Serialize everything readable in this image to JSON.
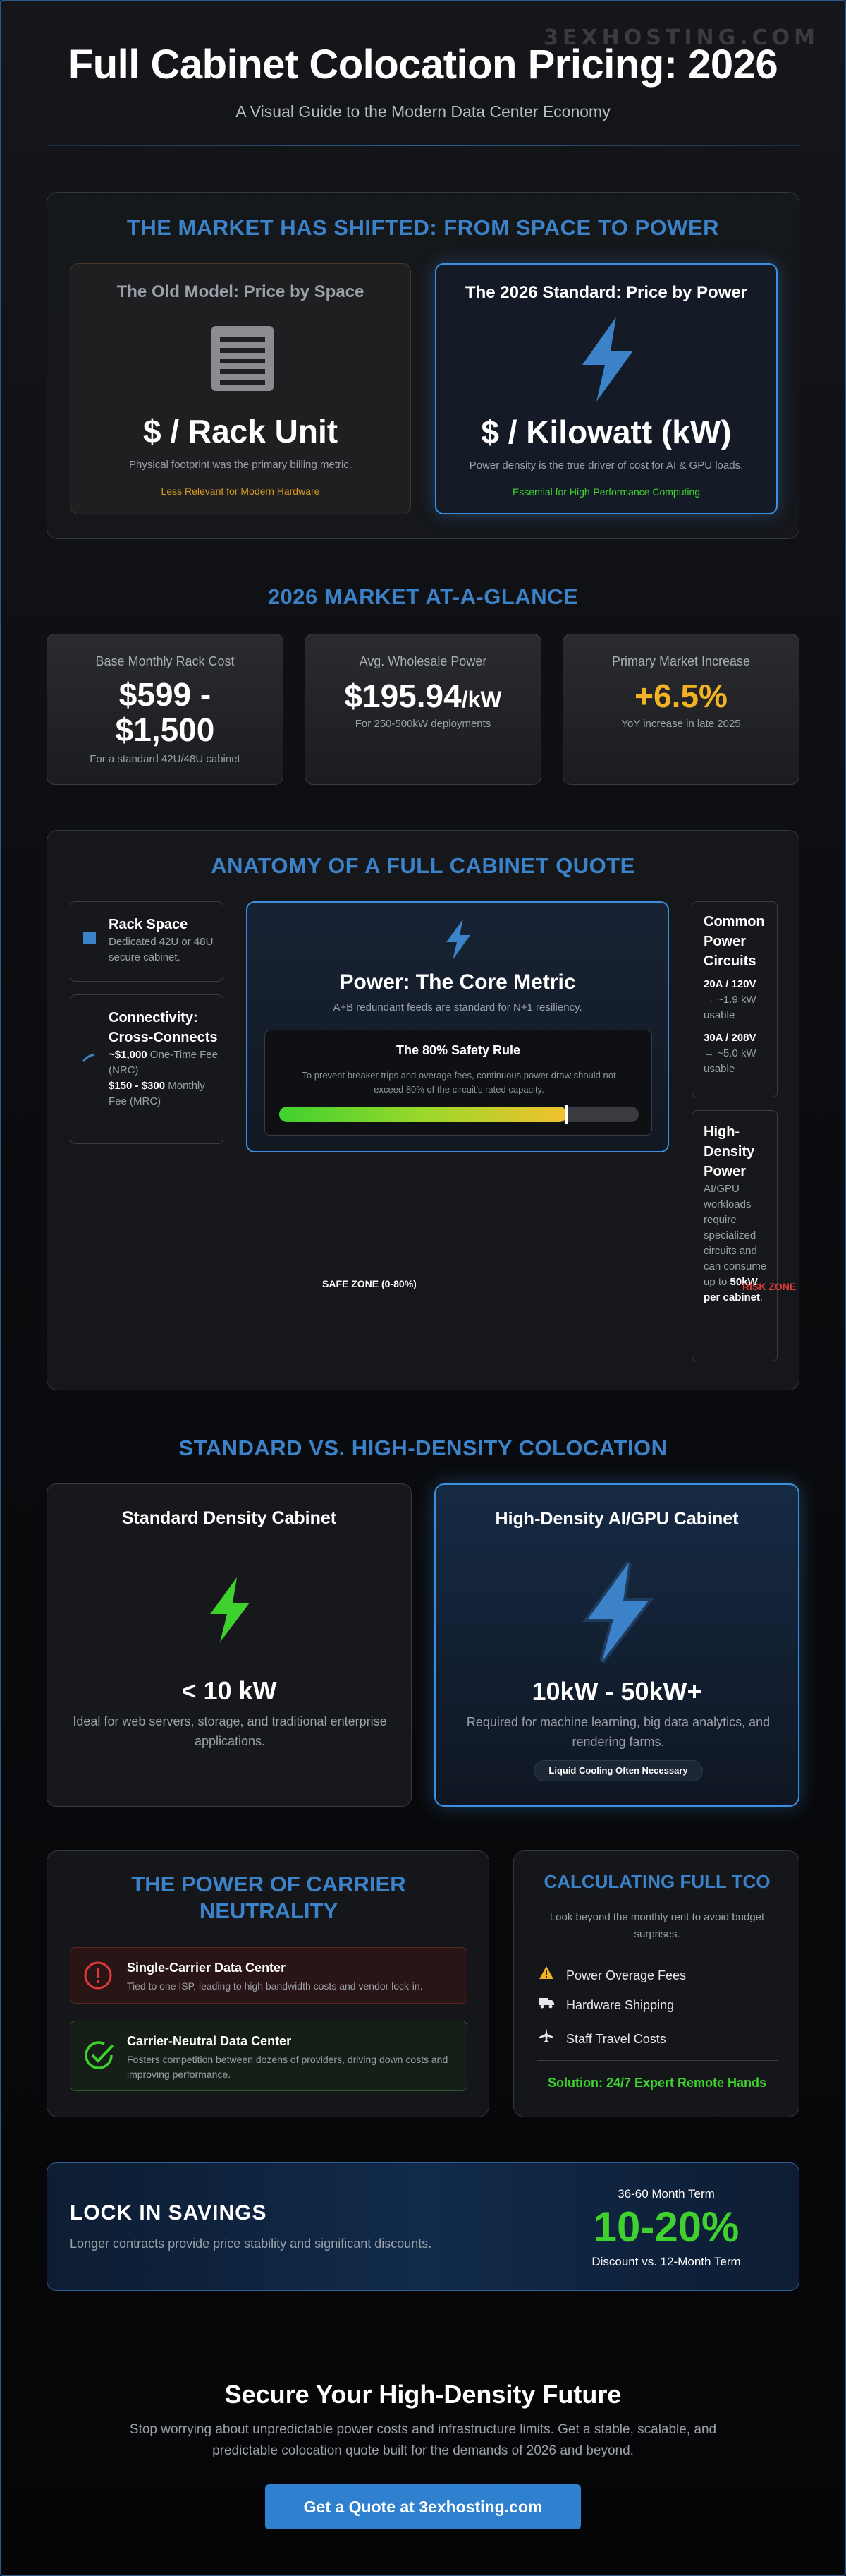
{
  "brand": {
    "watermark": "3EXHOSTING.COM"
  },
  "hero": {
    "title": "Full Cabinet Colocation Pricing: 2026",
    "subtitle": "A Visual Guide to the Modern Data Center Economy"
  },
  "shift": {
    "title": "THE MARKET HAS SHIFTED: FROM SPACE TO POWER",
    "old": {
      "title": "The Old Model: Price by Space",
      "metric": "$ / Rack Unit",
      "desc": "Physical footprint was the primary billing metric.",
      "tag": "Less Relevant for Modern Hardware",
      "icon": "rack-server-icon"
    },
    "new": {
      "title": "The 2026 Standard: Price by Power",
      "metric": "$ / Kilowatt (kW)",
      "desc": "Power density is the true driver of cost for AI & GPU loads.",
      "tag": "Essential for High-Performance Computing",
      "icon": "lightning-bolt-icon"
    }
  },
  "glance": {
    "title": "2026 MARKET AT-A-GLANCE",
    "cards": [
      {
        "label": "Base Monthly Rack Cost",
        "value": "$599 -",
        "value2": "$1,500",
        "note": "For a standard 42U/48U cabinet"
      },
      {
        "label": "Avg. Wholesale Power",
        "value": "$195.94",
        "unit": "/kW",
        "note": "For 250-500kW deployments"
      },
      {
        "label": "Primary Market Increase",
        "value": "+6.5%",
        "note": "YoY increase in late 2025"
      }
    ]
  },
  "anatomy": {
    "title": "ANATOMY OF A FULL CABINET QUOTE",
    "rack": {
      "title": "Rack Space",
      "desc": "Dedicated 42U or 48U secure cabinet."
    },
    "connect": {
      "title": "Connectivity: Cross-Connects",
      "line1_strong": "~$1,000",
      "line1_rest": " One-Time Fee (NRC)",
      "line2_strong": "$150 - $300",
      "line2_rest": " Monthly Fee (MRC)"
    },
    "core": {
      "title": "Power: The Core Metric",
      "desc": "A+B redundant feeds are standard for N+1 resiliency.",
      "rule_title": "The 80% Safety Rule",
      "rule_desc": "To prevent breaker trips and overage fees, continuous power draw should not exceed 80% of the circuit's rated capacity.",
      "safe_label": "SAFE ZONE (0-80%)",
      "risk_label": "RISK ZONE",
      "safe_fraction": 0.8
    },
    "circuits": {
      "title": "Common Power Circuits",
      "c1_label": "20A / 120V",
      "c1_desc": "→ ~1.9 kW usable",
      "c2_label": "30A / 208V",
      "c2_desc": "→ ~5.0 kW usable"
    },
    "hd": {
      "title": "High-Density Power",
      "desc": "AI/GPU workloads require specialized circuits and can consume up to ",
      "strong": "50kW per cabinet",
      "end": "."
    }
  },
  "density": {
    "title": "STANDARD VS. HIGH-DENSITY COLOCATION",
    "std": {
      "title": "Standard Density Cabinet",
      "value": "< 10 kW",
      "desc": "Ideal for web servers, storage, and traditional enterprise applications."
    },
    "hd": {
      "title": "High-Density AI/GPU Cabinet",
      "value": "10kW - 50kW+",
      "desc": "Required for machine learning, big data analytics, and rendering farms.",
      "pill": "Liquid Cooling Often Necessary"
    }
  },
  "neutral": {
    "title": "THE POWER OF CARRIER NEUTRALITY",
    "single": {
      "title": "Single-Carrier Data Center",
      "desc": "Tied to one ISP, leading to high bandwidth costs and vendor lock-in."
    },
    "multi": {
      "title": "Carrier-Neutral Data Center",
      "desc": "Fosters competition between dozens of providers, driving down costs and improving performance."
    }
  },
  "tco": {
    "title": "CALCULATING FULL TCO",
    "desc": "Look beyond the monthly rent to avoid budget surprises.",
    "items": [
      "Power Overage Fees",
      "Hardware Shipping",
      "Staff Travel Costs"
    ],
    "solution": "Solution: 24/7 Expert Remote Hands"
  },
  "savings": {
    "title": "LOCK IN SAVINGS",
    "desc": "Longer contracts provide price stability and significant discounts.",
    "term": "36-60 Month Term",
    "value": "10-20%",
    "note": "Discount vs. 12-Month Term"
  },
  "cta": {
    "title": "Secure Your High-Density Future",
    "desc": "Stop worrying about unpredictable power costs and infrastructure limits. Get a stable, scalable, and predictable colocation quote built for the demands of 2026 and beyond.",
    "button": "Get a Quote at 3exhosting.com"
  },
  "colors": {
    "accent": "#3b82c9",
    "green": "#3fd12e",
    "amber": "#f2b322",
    "red": "#e03b3b"
  }
}
